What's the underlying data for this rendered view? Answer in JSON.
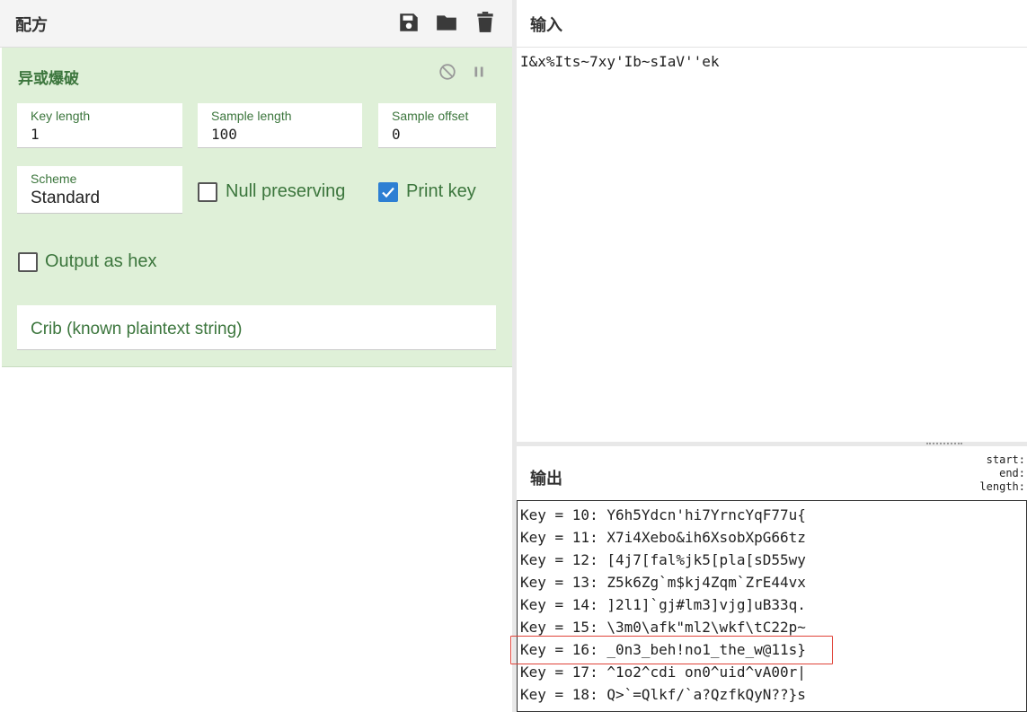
{
  "recipe": {
    "title": "配方",
    "operation": {
      "title": "异或爆破",
      "key_length": {
        "label": "Key length",
        "value": "1"
      },
      "sample_length": {
        "label": "Sample length",
        "value": "100"
      },
      "sample_offset": {
        "label": "Sample offset",
        "value": "0"
      },
      "scheme": {
        "label": "Scheme",
        "value": "Standard"
      },
      "null_preserving": {
        "label": "Null preserving",
        "checked": false
      },
      "print_key": {
        "label": "Print key",
        "checked": true
      },
      "output_as_hex": {
        "label": "Output as hex",
        "checked": false
      },
      "crib": {
        "placeholder": "Crib (known plaintext string)"
      }
    },
    "icons": [
      "save-icon",
      "folder-icon",
      "trash-icon",
      "disable-icon",
      "pause-icon"
    ]
  },
  "input": {
    "title": "输入",
    "text": "I&x%Its~7xy'Ib~sIaV''ek"
  },
  "output": {
    "title": "输出",
    "stats": {
      "start": "start:",
      "end": "end:",
      "length": "length:"
    },
    "lines": [
      "Key = 10: Y6h5Ydcn'hi7YrncYqF77u{",
      "Key = 11: X7i4Xebo&ih6XsobXpG66tz",
      "Key = 12: [4j7[fal%jk5[pla[sD55wy",
      "Key = 13: Z5k6Zg`m$kj4Zqm`ZrE44vx",
      "Key = 14: ]2l1]`gj#lm3]vjg]uB33q.",
      "Key = 15: \\3m0\\afk\"ml2\\wkf\\tC22p~",
      "Key = 16: _0n3_beh!no1_the_w@11s}",
      "Key = 17: ^1o2^cdi on0^uid^vA00r|",
      "Key = 18: Q>`=Qlkf/`a?QzfkQyN??}s"
    ],
    "highlighted_line": "Key = 16: _0n3_beh!no1_the_w@11s}"
  }
}
